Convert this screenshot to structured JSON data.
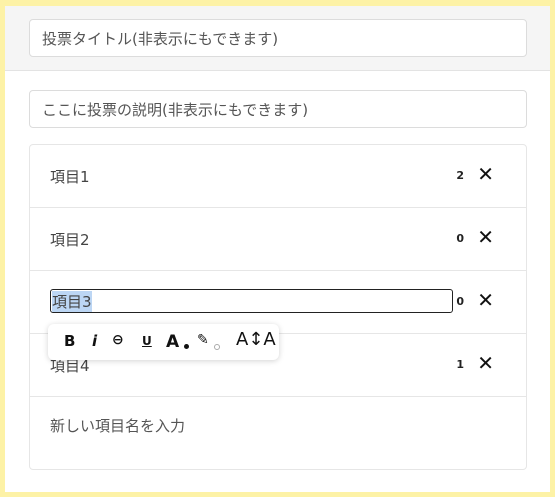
{
  "title_placeholder": "投票タイトル(非表示にもできます)",
  "description_placeholder": "ここに投票の説明(非表示にもできます)",
  "items": [
    {
      "label": "項目1",
      "count": "2"
    },
    {
      "label": "項目2",
      "count": "0"
    },
    {
      "label": "項目3",
      "count": "0",
      "editing": true
    },
    {
      "label": "項目4",
      "count": "1"
    }
  ],
  "delete_glyph": "✕",
  "new_item_placeholder": "新しい項目名を入力",
  "toolbar": {
    "bold": "B",
    "italic": "i",
    "link": "⊖",
    "underline": "U",
    "text_color": "A",
    "highlight": "✎",
    "font_size": "A↕A"
  },
  "colors": {
    "page_background": "#fdf2a6",
    "selection": "#bcd6f4"
  }
}
